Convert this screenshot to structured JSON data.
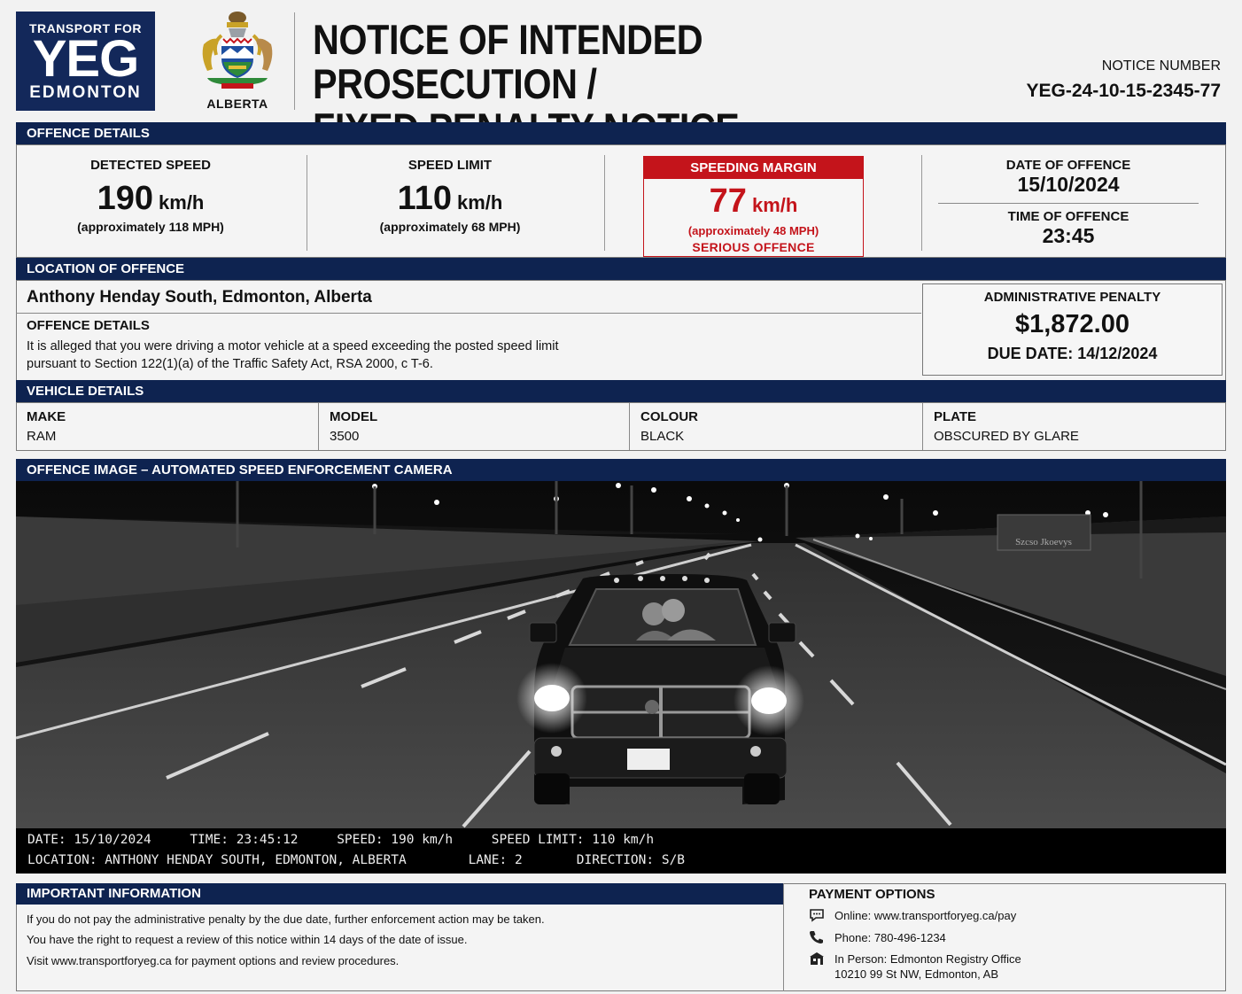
{
  "header": {
    "logo_line1": "TRANSPORT FOR",
    "logo_line2": "YEG",
    "logo_line3": "EDMONTON",
    "crest_name": "ALBERTA",
    "title_line1": "NOTICE OF INTENDED PROSECUTION /",
    "title_line2": "FIXED PENALTY NOTICE",
    "notice_label": "NOTICE NUMBER",
    "notice_number": "YEG-24-10-15-2345-77"
  },
  "offence": {
    "section_title": "OFFENCE DETAILS",
    "detected_label": "DETECTED SPEED",
    "detected_value": "190",
    "detected_unit": "km/h",
    "detected_sub": "(approximately 118 MPH)",
    "limit_label": "SPEED LIMIT",
    "limit_value": "110",
    "limit_unit": "km/h",
    "limit_sub": "(approximately 68 MPH)",
    "margin_label": "SPEEDING MARGIN",
    "margin_value": "77",
    "margin_unit": "km/h",
    "margin_sub": "(approximately 48 MPH)",
    "margin_note": "SERIOUS OFFENCE",
    "date_label": "DATE OF OFFENCE",
    "date_value": "15/10/2024",
    "time_label": "TIME OF OFFENCE",
    "time_value": "23:45"
  },
  "location": {
    "section_title": "LOCATION OF OFFENCE",
    "name": "Anthony Henday South, Edmonton, Alberta",
    "details_label": "OFFENCE DETAILS",
    "details_line1": "It is alleged that you were driving a motor vehicle at a speed exceeding the posted speed limit",
    "details_line2": "pursuant to Section 122(1)(a) of the Traffic Safety Act, RSA 2000, c T-6."
  },
  "penalty": {
    "label": "ADMINISTRATIVE PENALTY",
    "amount": "$1,872.00",
    "due": "DUE DATE: 14/12/2024"
  },
  "vehicle": {
    "section_title": "VEHICLE DETAILS",
    "make_label": "MAKE",
    "make": "RAM",
    "model_label": "MODEL",
    "model": "3500",
    "colour_label": "COLOUR",
    "colour": "BLACK",
    "plate_label": "PLATE",
    "plate": "OBSCURED BY GLARE"
  },
  "camera": {
    "section_title": "OFFENCE IMAGE – AUTOMATED SPEED ENFORCEMENT CAMERA",
    "sign_text": "Szcso Jkoevys",
    "meta_line1": "DATE: 15/10/2024     TIME: 23:45:12     SPEED: 190 km/h     SPEED LIMIT: 110 km/h",
    "meta_line2": "LOCATION: ANTHONY HENDAY SOUTH, EDMONTON, ALBERTA        LANE: 2       DIRECTION: S/B"
  },
  "info": {
    "section_title": "IMPORTANT INFORMATION",
    "line1": "If you do not pay the administrative penalty by the due date, further enforcement action may be taken.",
    "line2": "You have the right to request a review of this notice within 14 days of the date of issue.",
    "line3": "Visit www.transportforyeg.ca for payment options and review procedures."
  },
  "payment": {
    "title": "PAYMENT OPTIONS",
    "online": "Online: www.transportforyeg.ca/pay",
    "phone": "Phone: 780-496-1234",
    "in_person_line1": "In Person: Edmonton Registry Office",
    "in_person_line2": "10210 99 St NW, Edmonton, AB",
    "icons": [
      "online-icon",
      "phone-icon",
      "office-icon"
    ]
  },
  "colors": {
    "navy": "#0e2350",
    "alert_red": "#c4141b"
  }
}
